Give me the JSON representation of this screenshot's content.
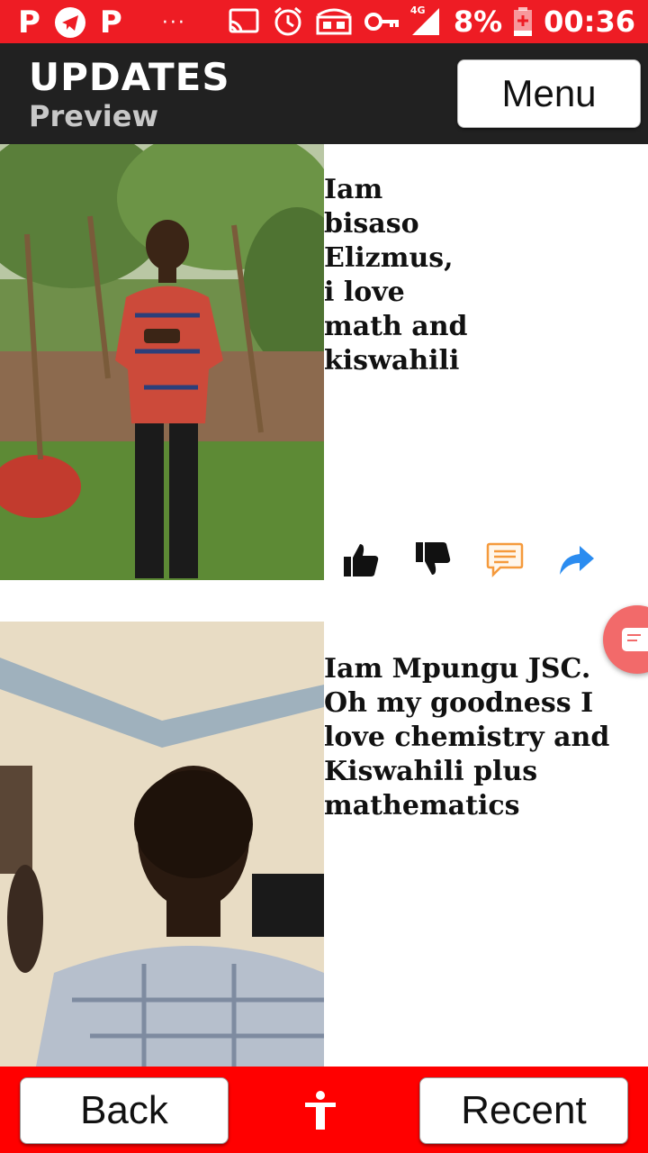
{
  "status_bar": {
    "left_icons": [
      "p-app-icon",
      "telegram-icon",
      "p-app-icon-2",
      "more-dots-icon"
    ],
    "right_icons": [
      "cast-icon",
      "alarm-icon",
      "voip-icon",
      "key-icon",
      "signal-4g-icon"
    ],
    "p1": "P",
    "p2": "P",
    "dots": "···",
    "network": "4G",
    "battery": "8%",
    "time": "00:36"
  },
  "header": {
    "title": "UPDATES",
    "subtitle": "Preview",
    "menu_label": "Menu"
  },
  "posts": [
    {
      "text": "Iam bisaso Elizmus, i love math and kiswahili",
      "photo": "boy-standing-in-garden-photo"
    },
    {
      "text": "Iam Mpungu JSC. Oh my goodness I love chemistry and Kiswahili plus mathematics",
      "photo": "boy-selfie-photo"
    }
  ],
  "actions": [
    "thumbs-up-icon",
    "thumbs-down-icon",
    "comment-icon",
    "share-icon"
  ],
  "footer": {
    "back_label": "Back",
    "recent_label": "Recent",
    "center_icon": "accessibility-icon"
  },
  "colors": {
    "status_bar": "#ee1c24",
    "header": "#212121",
    "footer": "#ff0000",
    "fab": "#f26a6a"
  }
}
